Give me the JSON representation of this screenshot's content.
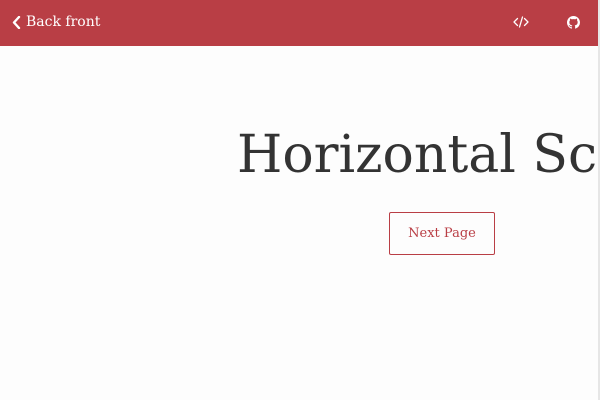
{
  "header": {
    "back_label": "Back front",
    "icons": {
      "back": "chevron-left-icon",
      "code": "code-icon",
      "github": "github-icon"
    },
    "background_color": "#b93e45"
  },
  "main": {
    "title": "Horizontal Scroll",
    "next_button_label": "Next Page",
    "accent_color": "#b93e45",
    "text_color": "#333333"
  }
}
